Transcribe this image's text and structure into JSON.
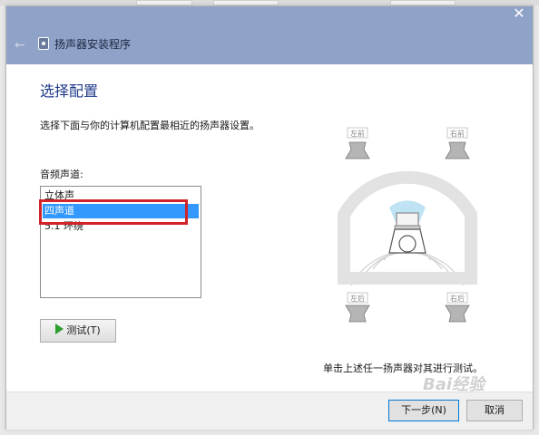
{
  "window": {
    "title": "扬声器安装程序",
    "close": "✕",
    "back": "←"
  },
  "page": {
    "heading": "选择配置",
    "description": "选择下面与你的计算机配置最相近的扬声器设置。",
    "channel_label": "音频声道:"
  },
  "channels": {
    "items": [
      "立体声",
      "四声道",
      "5.1 环绕"
    ],
    "selected": "四声道"
  },
  "test_button": {
    "label": "测试(T)",
    "icon": "play-icon"
  },
  "speakers": {
    "front_left": "左前",
    "front_right": "右前",
    "rear_left": "左后",
    "rear_right": "右后"
  },
  "hint": "单击上述任一扬声器对其进行测试。",
  "footer": {
    "next_label": "下一步(N)",
    "cancel_label": "取消"
  },
  "watermark": "Bai经验",
  "colors": {
    "titlebar": "#8fa2c8",
    "selection": "#3399ff",
    "highlight_box": "#d2232a",
    "heading": "#1f3a8a"
  }
}
